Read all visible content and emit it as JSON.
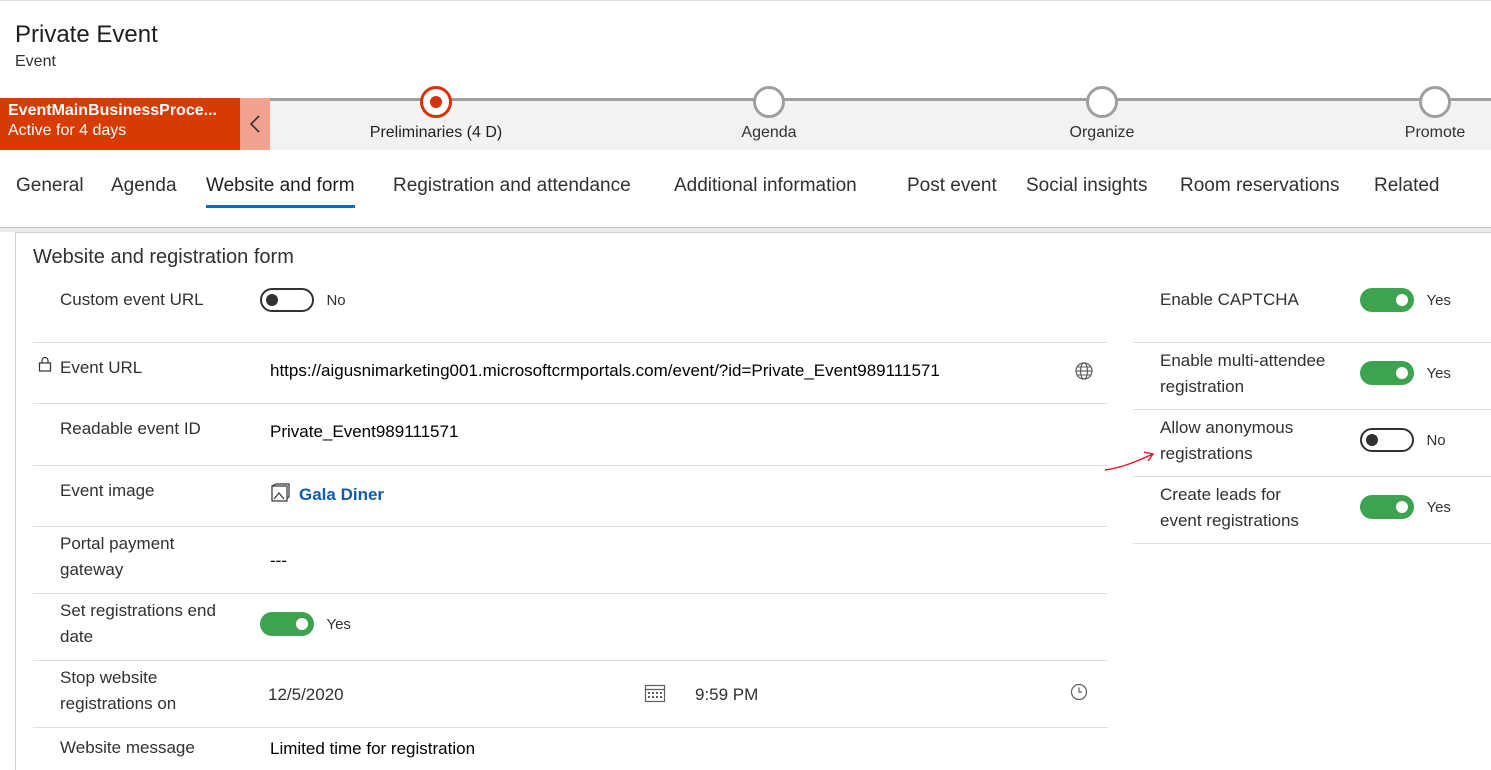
{
  "header": {
    "title": "Private Event",
    "subtitle": "Event"
  },
  "bpf": {
    "name": "EventMainBusinessProce...",
    "status": "Active for 4 days",
    "stages": [
      {
        "label": "Preliminaries  (4 D)",
        "active": true
      },
      {
        "label": "Agenda",
        "active": false
      },
      {
        "label": "Organize",
        "active": false
      },
      {
        "label": "Promote",
        "active": false
      }
    ]
  },
  "tabs": [
    "General",
    "Agenda",
    "Website and form",
    "Registration and attendance",
    "Additional information",
    "Post event",
    "Social insights",
    "Room reservations",
    "Related"
  ],
  "active_tab": "Website and form",
  "section": {
    "title": "Website and registration form",
    "left": {
      "custom_event_url": {
        "label": "Custom event URL",
        "value": "No"
      },
      "event_url": {
        "label": "Event URL",
        "value": "https://aigusnimarketing001.microsoftcrmportals.com/event/?id=Private_Event989111571"
      },
      "readable_event_id": {
        "label": "Readable event ID",
        "value": "Private_Event989111571"
      },
      "event_image": {
        "label": "Event image",
        "value": "Gala Diner"
      },
      "portal_payment_gateway": {
        "label": "Portal payment gateway",
        "value": "---"
      },
      "set_registrations_end_date": {
        "label": "Set registrations end date",
        "value": "Yes"
      },
      "stop_website_registrations_on": {
        "label": "Stop website registrations on",
        "date": "12/5/2020",
        "time": "9:59 PM"
      },
      "website_message": {
        "label": "Website message",
        "value": "Limited time for registration"
      }
    },
    "right": {
      "enable_captcha": {
        "label": "Enable CAPTCHA",
        "value": "Yes"
      },
      "enable_multi_attendee": {
        "label": "Enable multi-attendee registration",
        "value": "Yes"
      },
      "allow_anonymous": {
        "label": "Allow anonymous registrations",
        "value": "No"
      },
      "create_leads": {
        "label": "Create leads for event registrations",
        "value": "Yes"
      }
    }
  },
  "colors": {
    "bpf_red": "#d83b01",
    "toggle_on": "#3da350",
    "tab_underline": "#0f6cbd",
    "link": "#0f5cb3",
    "annotation_arrow": "#e81123"
  },
  "icons": {
    "lock": "lock-icon",
    "globe": "globe-icon",
    "image": "image-icon",
    "calendar": "calendar-icon",
    "clock": "clock-icon",
    "chevron": "chevron-left-icon"
  }
}
